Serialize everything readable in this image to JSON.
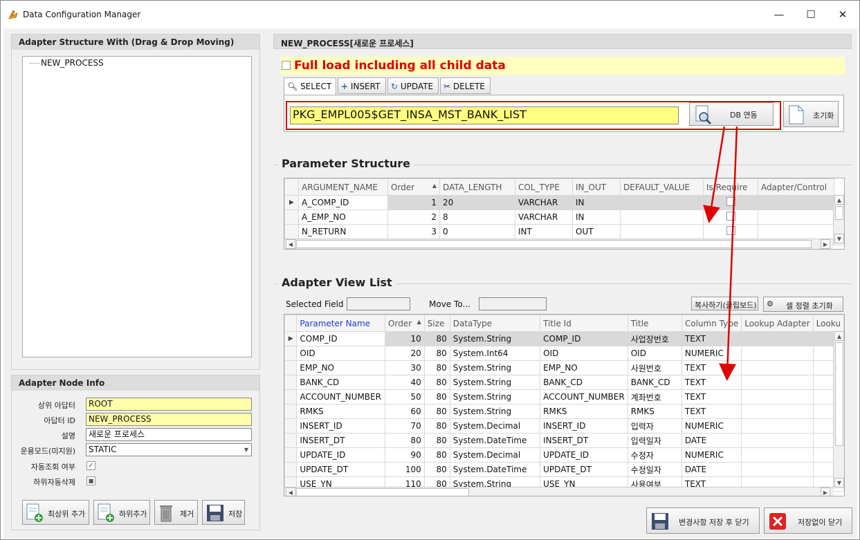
{
  "window": {
    "title": "Data Configuration Manager",
    "minimize": "—",
    "maximize": "☐",
    "close": "✕"
  },
  "left": {
    "structure_header": "Adapter Structure With (Drag & Drop Moving)",
    "tree_node": "NEW_PROCESS",
    "node_info_header": "Adapter Node Info",
    "fields": {
      "parent_label": "상위 아답터",
      "parent_value": "ROOT",
      "adapter_id_label": "아답터 ID",
      "adapter_id_value": "NEW_PROCESS",
      "desc_label": "설명",
      "desc_value": "새로운 프로세스",
      "mode_label": "운용모드(미지원)",
      "mode_value": "STATIC",
      "auto_label": "자동조회 여부",
      "child_del_label": "하위자동삭제"
    },
    "buttons": {
      "add_top": "최상위 추가",
      "add_child": "하위추가",
      "remove": "제거",
      "save": "저장"
    }
  },
  "right": {
    "header": "NEW_PROCESS[새로운 프로세스]",
    "full_load": "Full load including all child data",
    "tabs": [
      "SELECT",
      "INSERT",
      "UPDATE",
      "DELETE"
    ],
    "proc_name": "PKG_EMPL005$GET_INSA_MST_BANK_LIST",
    "db_link_button": "DB 연동",
    "reset_button": "초기화",
    "param_title": "Parameter Structure",
    "param_columns": [
      "ARGUMENT_NAME",
      "Order",
      "DATA_LENGTH",
      "COL_TYPE",
      "IN_OUT",
      "DEFAULT_VALUE",
      "Is Require",
      "Adapter/Control"
    ],
    "param_rows": [
      {
        "name": "A_COMP_ID",
        "order": "1",
        "length": "20",
        "type": "VARCHAR",
        "inout": "IN",
        "default": ""
      },
      {
        "name": "A_EMP_NO",
        "order": "2",
        "length": "8",
        "type": "VARCHAR",
        "inout": "IN",
        "default": ""
      },
      {
        "name": "N_RETURN",
        "order": "3",
        "length": "0",
        "type": "INT",
        "inout": "OUT",
        "default": ""
      }
    ],
    "view_title": "Adapter View List",
    "selected_field_label": "Selected Field",
    "move_to_label": "Move To...",
    "copy_button": "복사하기(클립보드)",
    "cell_reset_button": "셀 정렬 초기화",
    "view_columns": [
      "Parameter Name",
      "Order",
      "Size",
      "DataType",
      "Title Id",
      "Title",
      "Column Type",
      "Lookup Adapter",
      "Looku"
    ],
    "view_rows": [
      {
        "param": "COMP_ID",
        "order": "10",
        "size": "80",
        "dtype": "System.String",
        "tid": "COMP_ID",
        "title": "사업장번호",
        "ctype": "TEXT"
      },
      {
        "param": "OID",
        "order": "20",
        "size": "80",
        "dtype": "System.Int64",
        "tid": "OID",
        "title": "OID",
        "ctype": "NUMERIC"
      },
      {
        "param": "EMP_NO",
        "order": "30",
        "size": "80",
        "dtype": "System.String",
        "tid": "EMP_NO",
        "title": "사원번호",
        "ctype": "TEXT"
      },
      {
        "param": "BANK_CD",
        "order": "40",
        "size": "80",
        "dtype": "System.String",
        "tid": "BANK_CD",
        "title": "BANK_CD",
        "ctype": "TEXT"
      },
      {
        "param": "ACCOUNT_NUMBER",
        "order": "50",
        "size": "80",
        "dtype": "System.String",
        "tid": "ACCOUNT_NUMBER",
        "title": "계좌번호",
        "ctype": "TEXT"
      },
      {
        "param": "RMKS",
        "order": "60",
        "size": "80",
        "dtype": "System.String",
        "tid": "RMKS",
        "title": "RMKS",
        "ctype": "TEXT"
      },
      {
        "param": "INSERT_ID",
        "order": "70",
        "size": "80",
        "dtype": "System.Decimal",
        "tid": "INSERT_ID",
        "title": "입력자",
        "ctype": "NUMERIC"
      },
      {
        "param": "INSERT_DT",
        "order": "80",
        "size": "80",
        "dtype": "System.DateTime",
        "tid": "INSERT_DT",
        "title": "입력일자",
        "ctype": "DATE"
      },
      {
        "param": "UPDATE_ID",
        "order": "90",
        "size": "80",
        "dtype": "System.Decimal",
        "tid": "UPDATE_ID",
        "title": "수정자",
        "ctype": "NUMERIC"
      },
      {
        "param": "UPDATE_DT",
        "order": "100",
        "size": "80",
        "dtype": "System.DateTime",
        "tid": "UPDATE_DT",
        "title": "수정일자",
        "ctype": "DATE"
      },
      {
        "param": "USE_YN",
        "order": "110",
        "size": "80",
        "dtype": "System.String",
        "tid": "USE_YN",
        "title": "사용여부",
        "ctype": "TEXT"
      }
    ],
    "save_close_button": "변경사항 저장 후 닫기",
    "close_nosave_button": "저장없이 닫기"
  },
  "colors": {
    "highlight_red": "#e00000",
    "input_yellow": "#ffffa8",
    "header_gray": "#dcdcdc"
  }
}
